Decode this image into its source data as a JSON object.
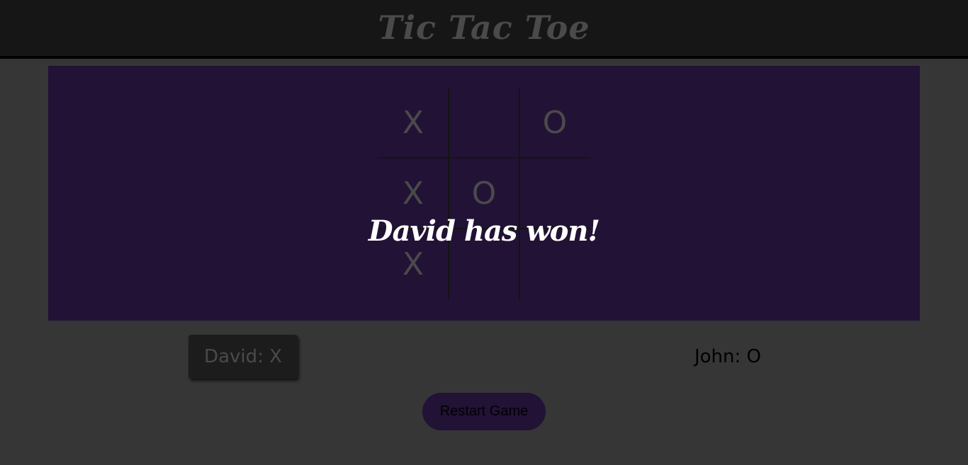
{
  "header": {
    "title": "Tic Tac Toe"
  },
  "board": {
    "cells": [
      "X",
      "",
      "O",
      "X",
      "O",
      "",
      "X",
      "",
      ""
    ]
  },
  "message": {
    "text": "David has won!"
  },
  "players": {
    "one": {
      "label": "David: X",
      "active": true
    },
    "two": {
      "label": "John: O",
      "active": false
    }
  },
  "controls": {
    "restart_label": "Restart Game"
  },
  "colors": {
    "page_background": "#363636",
    "header_background": "#161616",
    "board_background": "#221236",
    "accent": "#221236",
    "mark_color": "#4a4a4a",
    "message_color": "#ffffff"
  }
}
